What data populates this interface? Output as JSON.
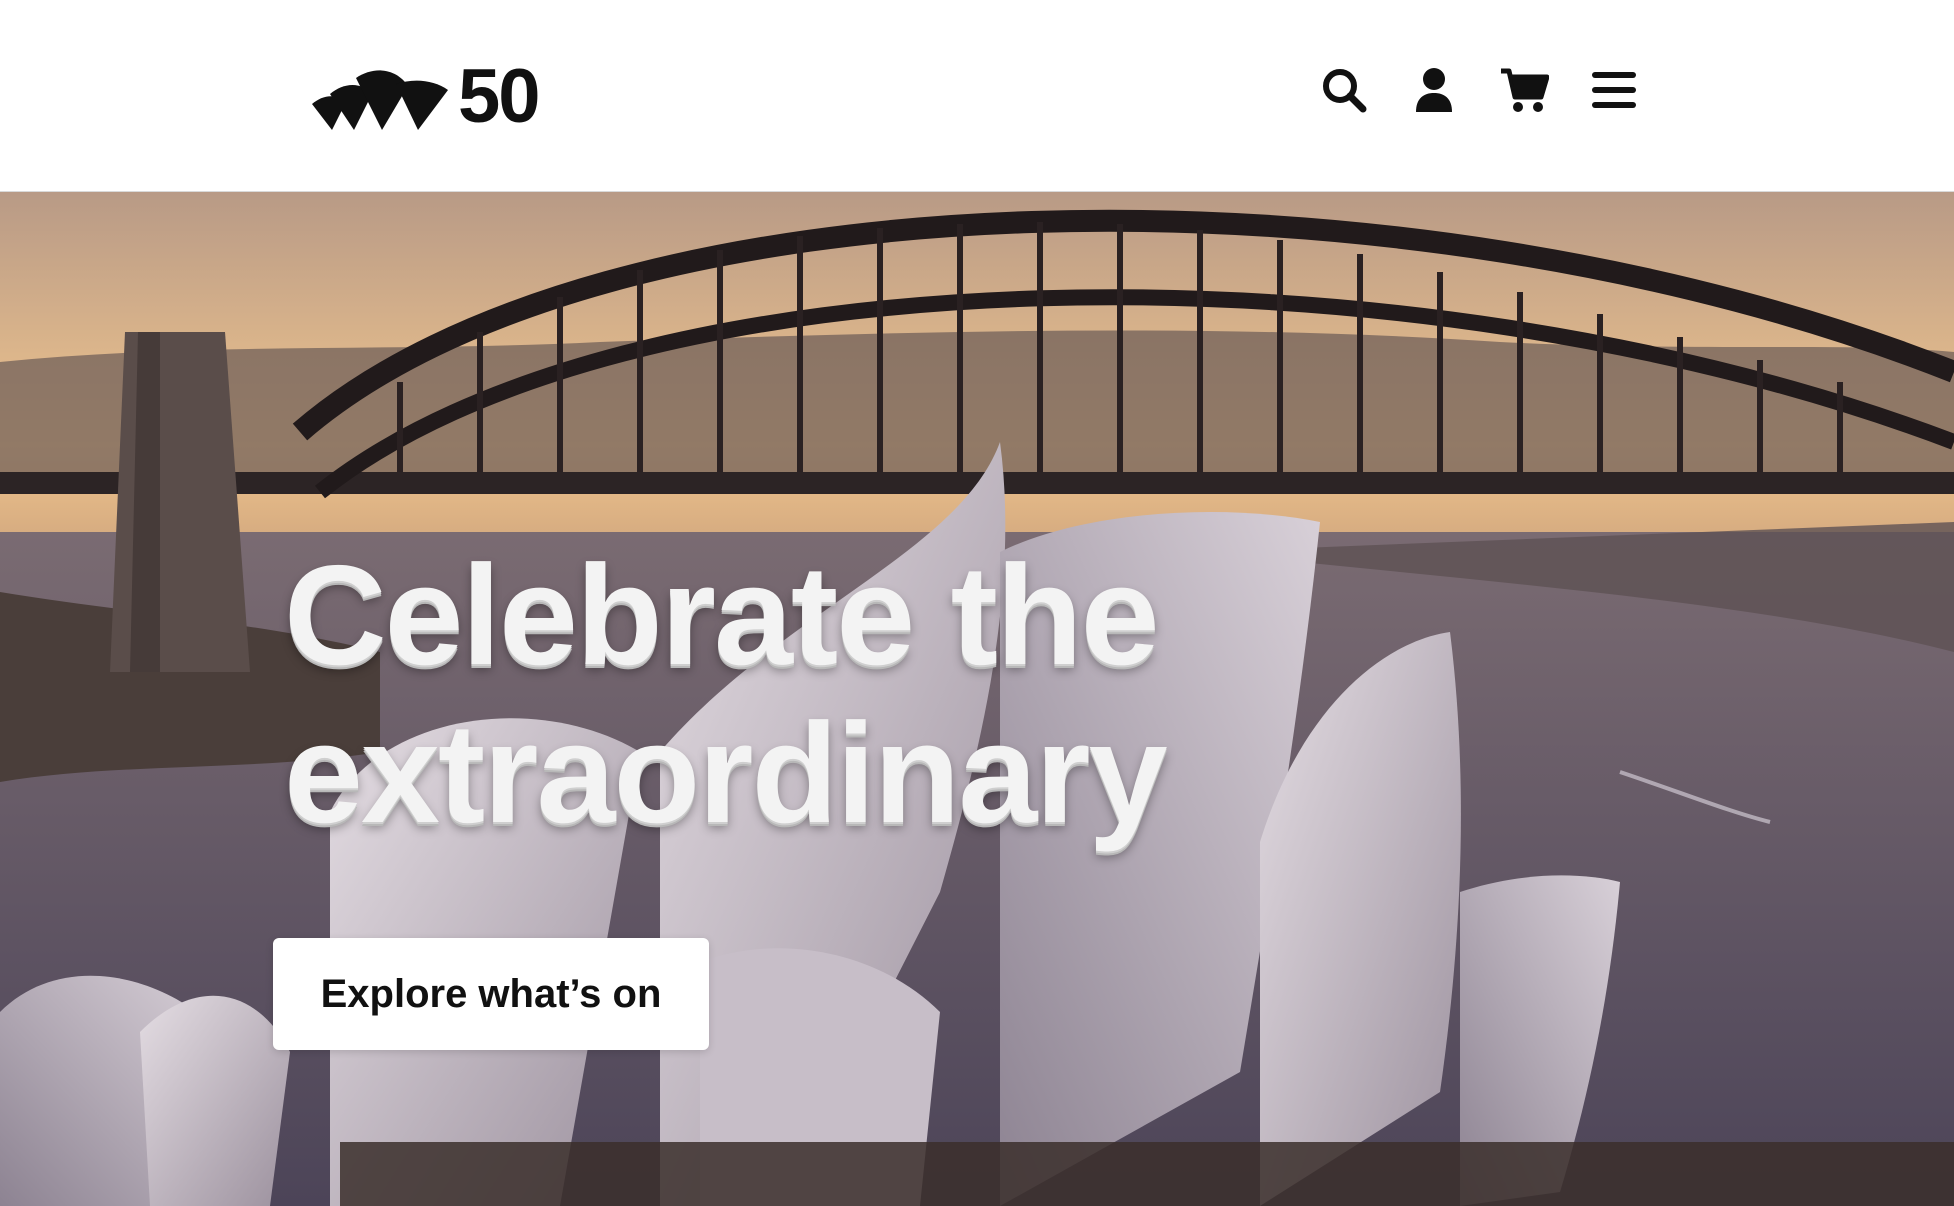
{
  "header": {
    "logo_text": "50",
    "actions": [
      {
        "icon": "search-icon"
      },
      {
        "icon": "account-icon"
      },
      {
        "icon": "cart-icon"
      },
      {
        "icon": "menu-icon"
      }
    ]
  },
  "hero": {
    "headline_line1": "Celebrate the",
    "headline_line2": "extraordinary",
    "cta_label": "Explore what’s on"
  },
  "colors": {
    "header_bg": "#ffffff",
    "icon": "#111111",
    "cta_bg": "#ffffff",
    "cta_text": "#111111",
    "headline": "#f3f3f3"
  }
}
